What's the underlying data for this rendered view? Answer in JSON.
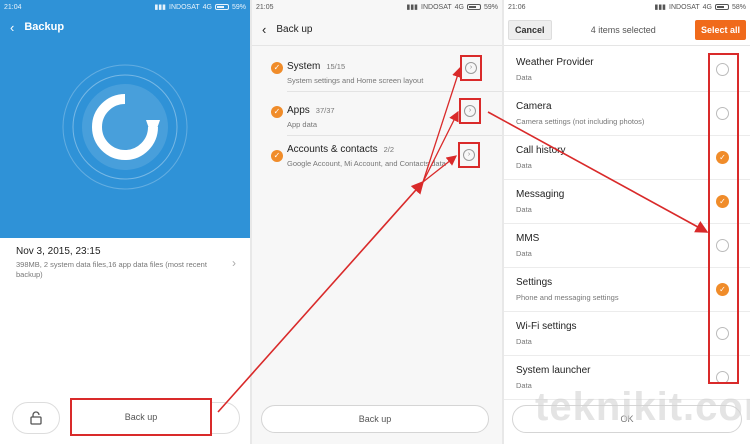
{
  "status": {
    "time1": "21:04",
    "time2": "21:05",
    "time3": "21:06",
    "carrier": "INDOSAT",
    "network": "4G",
    "battery1": "59%",
    "battery2": "59%",
    "battery3": "58%"
  },
  "panel1": {
    "title": "Backup",
    "entry_title": "Nov 3, 2015, 23:15",
    "entry_desc": "398MB, 2 system data files,16 app data files (most recent backup)",
    "backup_button": "Back up"
  },
  "panel2": {
    "title": "Back up",
    "items": [
      {
        "name": "System",
        "count": "15/15",
        "desc": "System settings and Home screen layout"
      },
      {
        "name": "Apps",
        "count": "37/37",
        "desc": "App data"
      },
      {
        "name": "Accounts & contacts",
        "count": "2/2",
        "desc": "Google Account, Mi Account, and Contacts data"
      }
    ],
    "backup_button": "Back up"
  },
  "panel3": {
    "cancel": "Cancel",
    "selected": "4 items selected",
    "select_all": "Select all",
    "items": [
      {
        "name": "Weather Provider",
        "desc": "Data",
        "checked": false
      },
      {
        "name": "Camera",
        "desc": "Camera settings (not including photos)",
        "checked": false
      },
      {
        "name": "Call history",
        "desc": "Data",
        "checked": true
      },
      {
        "name": "Messaging",
        "desc": "Data",
        "checked": true
      },
      {
        "name": "MMS",
        "desc": "Data",
        "checked": false
      },
      {
        "name": "Settings",
        "desc": "Phone and messaging settings",
        "checked": true
      },
      {
        "name": "Wi-Fi settings",
        "desc": "Data",
        "checked": false
      },
      {
        "name": "System launcher",
        "desc": "Data",
        "checked": false
      }
    ],
    "ok_button": "OK"
  },
  "watermark": "teknikit.com",
  "colors": {
    "accent_blue": "#2f92d7",
    "check_orange": "#f08c2a",
    "select_all": "#f06a1b",
    "annotation_red": "#d92a2a"
  }
}
